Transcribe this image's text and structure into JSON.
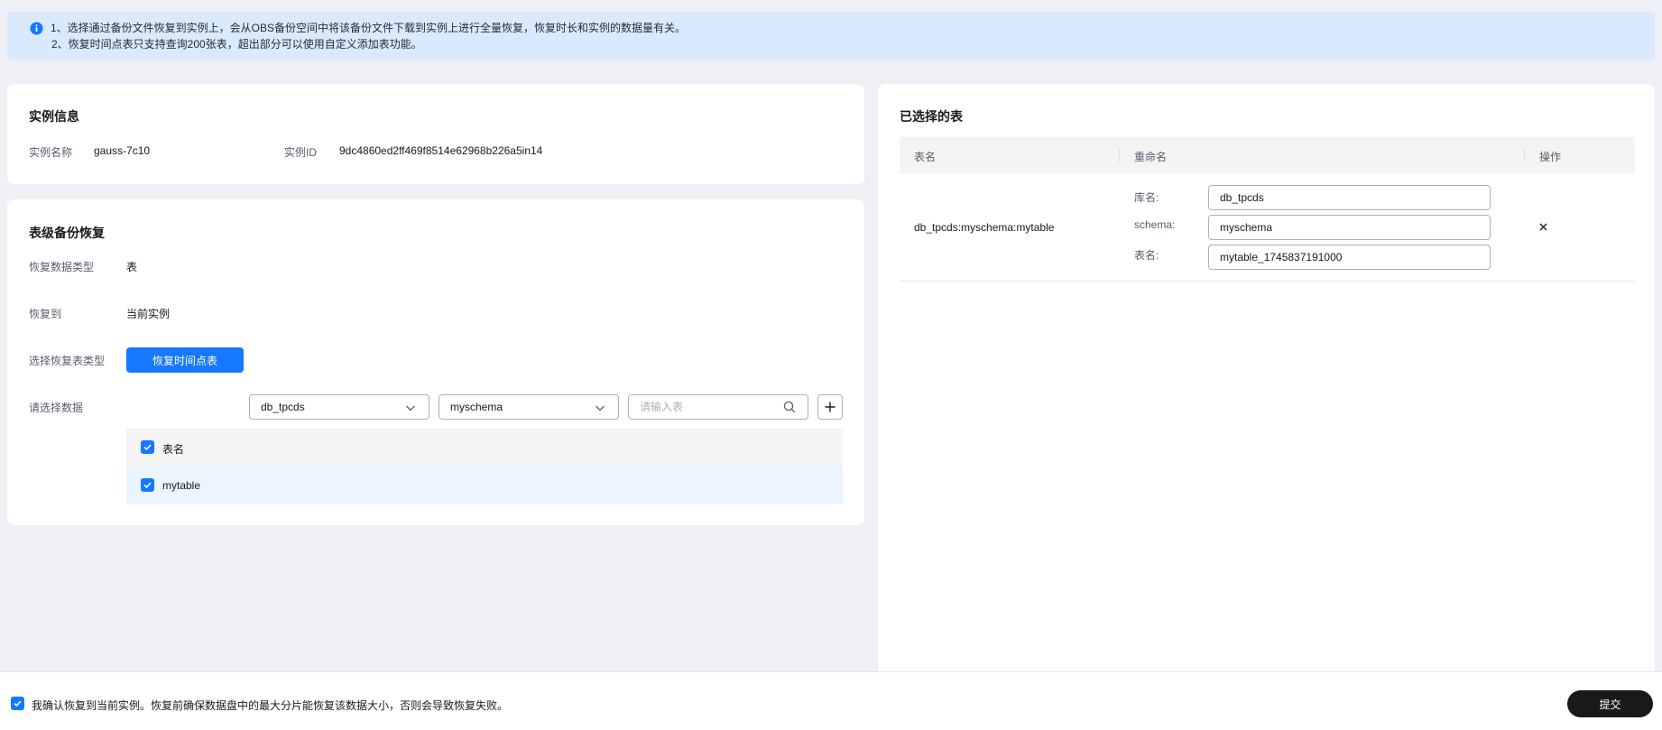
{
  "notice": {
    "line1": "1、选择通过备份文件恢复到实例上，会从OBS备份空间中将该备份文件下载到实例上进行全量恢复，恢复时长和实例的数据量有关。",
    "line2": "2、恢复时间点表只支持查询200张表，超出部分可以使用自定义添加表功能。"
  },
  "instance": {
    "title": "实例信息",
    "name_label": "实例名称",
    "name_value": "gauss-7c10",
    "id_label": "实例ID",
    "id_value": "9dc4860ed2ff469f8514e62968b226a5in14"
  },
  "restore": {
    "title": "表级备份恢复",
    "data_type_label": "恢复数据类型",
    "data_type_value": "表",
    "restore_to_label": "恢复到",
    "restore_to_value": "当前实例",
    "table_type_label": "选择恢复表类型",
    "table_type_button": "恢复时间点表",
    "select_data_label": "请选择数据",
    "db_select": "db_tpcds",
    "schema_select": "myschema",
    "search_placeholder": "请输入表",
    "table_header": "表名",
    "rows": [
      {
        "name": "mytable"
      }
    ]
  },
  "selected": {
    "title": "已选择的表",
    "columns": [
      "表名",
      "重命名",
      "操作"
    ],
    "row": {
      "table": "db_tpcds:myschema:mytable",
      "db_label": "库名:",
      "db_value": "db_tpcds",
      "schema_label": "schema:",
      "schema_value": "myschema",
      "table_label": "表名:",
      "table_value": "mytable_1745837191000"
    }
  },
  "footer": {
    "confirm_text": "我确认恢复到当前实例。恢复前确保数据盘中的最大分片能恢复该数据大小，否则会导致恢复失败。",
    "submit_label": "提交"
  },
  "colors": {
    "primary": "#1677ff",
    "notice_bg": "#dbe9fd",
    "submit_bg": "#191919"
  }
}
